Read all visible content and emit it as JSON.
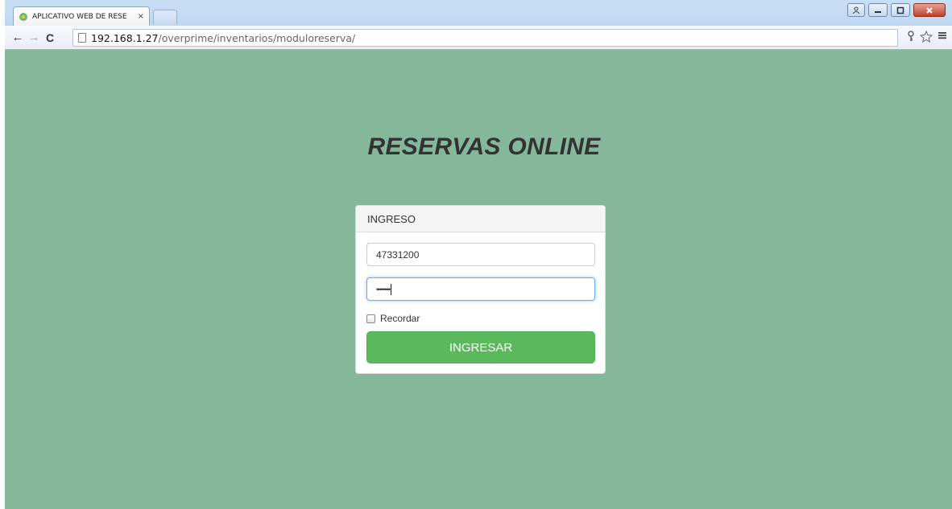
{
  "browser": {
    "tab_title": "APLICATIVO WEB DE RESE",
    "tab_close": "×",
    "url_host": "192.168.1.27",
    "url_path": "/overprime/inventarios/moduloreserva/"
  },
  "page": {
    "background": "#85b89a",
    "heading": "RESERVAS ONLINE"
  },
  "login": {
    "panel_title": "INGRESO",
    "username_value": "47331200",
    "password_mask": "••••••••",
    "remember_label": "Recordar",
    "remember_checked": false,
    "submit_label": "INGRESAR",
    "submit_color": "#5cb85c"
  }
}
